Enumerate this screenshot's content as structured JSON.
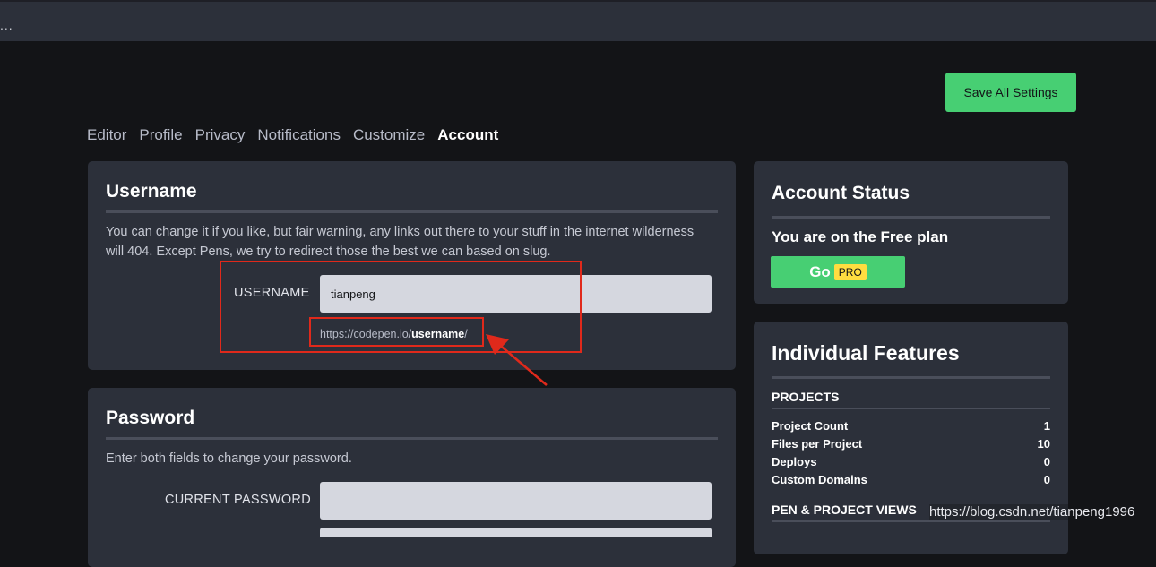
{
  "topbar": {
    "menu_dots": "..."
  },
  "header": {
    "save_label": "Save All Settings"
  },
  "tabs": [
    {
      "label": "Editor",
      "active": false
    },
    {
      "label": "Profile",
      "active": false
    },
    {
      "label": "Privacy",
      "active": false
    },
    {
      "label": "Notifications",
      "active": false
    },
    {
      "label": "Customize",
      "active": false
    },
    {
      "label": "Account",
      "active": true
    }
  ],
  "username_section": {
    "title": "Username",
    "description": "You can change it if you like, but fair warning, any links out there to your stuff in the internet wilderness will 404. Except Pens, we try to redirect those the best we can based on slug.",
    "field_label": "USERNAME",
    "field_value": "tianpeng",
    "url_prefix": "https://codepen.io/",
    "url_username": "username",
    "url_suffix": "/"
  },
  "password_section": {
    "title": "Password",
    "description": "Enter both fields to change your password.",
    "current_label": "CURRENT PASSWORD"
  },
  "account_status": {
    "title": "Account Status",
    "plan_text": "You are on the Free plan",
    "go_label": "Go",
    "pro_badge": "PRO"
  },
  "features": {
    "title": "Individual Features",
    "projects_heading": "PROJECTS",
    "rows": [
      {
        "label": "Project Count",
        "value": "1"
      },
      {
        "label": "Files per Project",
        "value": "10"
      },
      {
        "label": "Deploys",
        "value": "0"
      },
      {
        "label": "Custom Domains",
        "value": "0"
      }
    ],
    "views_heading": "PEN & PROJECT VIEWS"
  },
  "watermark": "https://blog.csdn.net/tianpeng1996",
  "colors": {
    "accent_green": "#47cf73",
    "pro_yellow": "#ffdd40",
    "annotation_red": "#e0291b"
  }
}
